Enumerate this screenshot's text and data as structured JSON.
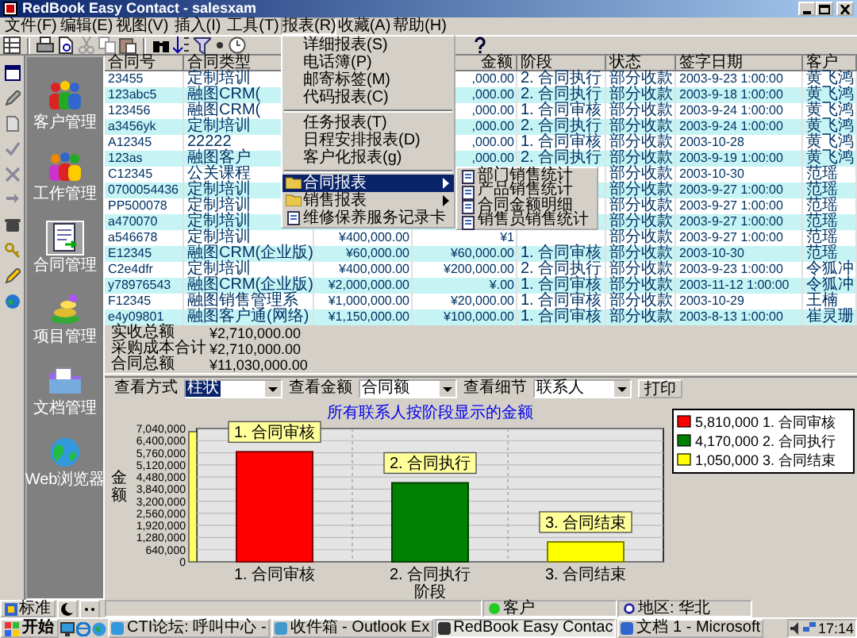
{
  "window": {
    "title": "RedBook Easy Contact - salesxam"
  },
  "menu_bar": [
    {
      "label": "文件(F)",
      "selected": false
    },
    {
      "label": "编辑(E)",
      "selected": false
    },
    {
      "label": "视图(V)",
      "selected": false
    },
    {
      "label": "插入(I)",
      "selected": false
    },
    {
      "label": "工具(T)",
      "selected": false
    },
    {
      "label": "报表(R)",
      "selected": true
    },
    {
      "label": "收藏(A)",
      "selected": false
    },
    {
      "label": "帮助(H)",
      "selected": false
    }
  ],
  "open_menu": {
    "items": [
      {
        "kind": "text",
        "label": "详细报表(S)",
        "selected": false
      },
      {
        "kind": "text",
        "label": "电话簿(P)",
        "selected": false
      },
      {
        "kind": "text",
        "label": "邮寄标签(M)",
        "selected": false
      },
      {
        "kind": "text",
        "label": "代码报表(C)",
        "selected": false
      },
      {
        "kind": "separator"
      },
      {
        "kind": "text",
        "label": "任务报表(T)",
        "selected": false
      },
      {
        "kind": "text",
        "label": "日程安排报表(D)",
        "selected": false
      },
      {
        "kind": "text",
        "label": "客户化报表(g)",
        "selected": false
      },
      {
        "kind": "separator"
      },
      {
        "kind": "folder",
        "label": "合同报表",
        "selected": true
      },
      {
        "kind": "folder",
        "label": "销售报表",
        "selected": false
      },
      {
        "kind": "page",
        "label": "维修保养服务记录卡",
        "selected": false
      }
    ]
  },
  "submenu": {
    "items": [
      "部门销售统计",
      "产品销售统计",
      "合同金额明细",
      "销售员销售统计"
    ]
  },
  "sidebar": {
    "items": [
      {
        "label": "客户管理",
        "selected": false
      },
      {
        "label": "工作管理",
        "selected": false
      },
      {
        "label": "合同管理",
        "selected": true
      },
      {
        "label": "项目管理",
        "selected": false
      },
      {
        "label": "文档管理",
        "selected": false
      },
      {
        "label": "Web浏览器",
        "selected": false
      }
    ]
  },
  "table": {
    "columns": [
      "合同号",
      "合同类型",
      null,
      "金额",
      "阶段",
      "状态",
      "签字日期",
      "客户"
    ],
    "rows": [
      {
        "cells": [
          "23455",
          "定制培训",
          null,
          ",000.00",
          "2. 合同执行",
          "部分收款",
          "2003-9-23 1:00:00",
          "黄飞鸿"
        ]
      },
      {
        "cells": [
          "123abc5",
          "融图CRM(",
          null,
          ",000.00",
          "2. 合同执行",
          "部分收款",
          "2003-9-18 1:00:00",
          "黄飞鸿"
        ]
      },
      {
        "cells": [
          "123456",
          "融图CRM(",
          null,
          ",000.00",
          "1. 合同审核",
          "部分收款",
          "2003-9-24 1:00:00",
          "黄飞鸿"
        ]
      },
      {
        "cells": [
          "a3456yk",
          "定制培训",
          null,
          ",000.00",
          "2. 合同执行",
          "部分收款",
          "2003-9-24 1:00:00",
          "黄飞鸿"
        ]
      },
      {
        "cells": [
          "A12345",
          "22222",
          null,
          ",000.00",
          "1. 合同审核",
          "部分收款",
          "2003-10-28",
          "黄飞鸿"
        ]
      },
      {
        "cells": [
          "123as",
          "融图客户",
          null,
          ",000.00",
          "2. 合同执行",
          "部分收款",
          "2003-9-19 1:00:00",
          "黄飞鸿"
        ]
      },
      {
        "cells": [
          "C12345",
          "公关课程",
          null,
          null,
          null,
          "部分收款",
          "2003-10-30",
          "范瑶"
        ]
      },
      {
        "cells": [
          "0700054436",
          "定制培训",
          null,
          null,
          null,
          "部分收款",
          "2003-9-27 1:00:00",
          "范瑶"
        ]
      },
      {
        "cells": [
          "PP500078",
          "定制培训",
          null,
          null,
          null,
          "部分收款",
          "2003-9-27 1:00:00",
          "范瑶"
        ]
      },
      {
        "cells": [
          "a470070",
          "定制培训",
          null,
          null,
          null,
          "部分收款",
          "2003-9-27 1:00:00",
          "范瑶"
        ]
      },
      {
        "cells": [
          "a546678",
          "定制培训",
          "¥400,000.00",
          "¥1",
          null,
          "部分收款",
          "2003-9-27 1:00:00",
          "范瑶"
        ]
      },
      {
        "cells": [
          "E12345",
          "融图CRM(企业版)",
          "¥60,000.00",
          "¥60,000.00",
          "1. 合同审核",
          "部分收款",
          "2003-10-30",
          "范瑶"
        ]
      },
      {
        "cells": [
          "C2e4dfr",
          "定制培训",
          "¥400,000.00",
          "¥200,000.00",
          "2. 合同执行",
          "部分收款",
          "2003-9-23 1:00:00",
          "令狐冲"
        ]
      },
      {
        "cells": [
          "y78976543",
          "融图CRM(企业版)",
          "¥2,000,000.00",
          "¥.00",
          "1. 合同审核",
          "部分收款",
          "2003-11-12 1:00:00",
          "令狐冲"
        ]
      },
      {
        "cells": [
          "F12345",
          "融图销售管理系",
          "¥1,000,000.00",
          "¥20,000.00",
          "1. 合同审核",
          "部分收款",
          "2003-10-29",
          "王楠"
        ]
      },
      {
        "cells": [
          "e4y09801",
          "融图客户通(网络)",
          "¥1,150,000.00",
          "¥100,000.00",
          "1. 合同审核",
          "部分收款",
          "2003-8-13 1:00:00",
          "崔灵珊"
        ]
      }
    ]
  },
  "totals": [
    {
      "label": "实收总额",
      "value": "¥2,710,000.00"
    },
    {
      "label": "采购成本合计",
      "value": "¥2,710,000.00"
    },
    {
      "label": "合同总额",
      "value": "¥11,030,000.00"
    }
  ],
  "filter_bar": {
    "fields": [
      {
        "label": "查看方式",
        "value": "柱状",
        "focused": true
      },
      {
        "label": "查看金额",
        "value": "合同额",
        "focused": false
      },
      {
        "label": "查看细节",
        "value": "联系人",
        "focused": false
      }
    ],
    "print_button": "打印"
  },
  "chart": {
    "chart_data": {
      "type": "bar",
      "title": "所有联系人按阶段显示的金额",
      "xlabel": "阶段",
      "ylabel": "金额",
      "categories": [
        "1. 合同审核",
        "2. 合同执行",
        "3. 合同结束"
      ],
      "series": [
        {
          "values": [
            5810000,
            4170000,
            1050000
          ]
        }
      ],
      "grid": true,
      "ylim": [
        0,
        7040000
      ],
      "yticks": [
        {
          "value": 0,
          "label": "0"
        },
        {
          "value": 640000,
          "label": "640,000"
        },
        {
          "value": 1280000,
          "label": "1,280,000"
        },
        {
          "value": 1920000,
          "label": "1,920,000"
        },
        {
          "value": 2560000,
          "label": "2,560,000"
        },
        {
          "value": 3200000,
          "label": "3,200,000"
        },
        {
          "value": 3840000,
          "label": "3,840,000"
        },
        {
          "value": 4480000,
          "label": "4,480,000"
        },
        {
          "value": 5120000,
          "label": "5,120,000"
        },
        {
          "value": 5760000,
          "label": "5,760,000"
        },
        {
          "value": 6400000,
          "label": "6,400,000"
        },
        {
          "value": 7040000,
          "label": "7,040,000"
        }
      ]
    },
    "bar_labels": [
      "1. 合同审核",
      "2. 合同执行",
      "3. 合同结束"
    ],
    "legend": [
      {
        "label": "5,810,000 1. 合同审核",
        "color": "#ff0000"
      },
      {
        "label": "4,170,000 2. 合同执行",
        "color": "#008000"
      },
      {
        "label": "1,050,000 3. 合同结束",
        "color": "#ffff00"
      }
    ]
  },
  "view_button": "标准",
  "status_bar": {
    "items": [
      "客户",
      "地区: 华北"
    ]
  },
  "taskbar": {
    "start": "开始",
    "tasks": [
      {
        "label": "CTI论坛: 呼叫中心 -",
        "selected": false
      },
      {
        "label": "收件箱 - Outlook Ex",
        "selected": false
      },
      {
        "label": "RedBook Easy Contac",
        "selected": true
      },
      {
        "label": "文档 1 - Microsoft",
        "selected": false
      }
    ],
    "clock": "17:14"
  }
}
